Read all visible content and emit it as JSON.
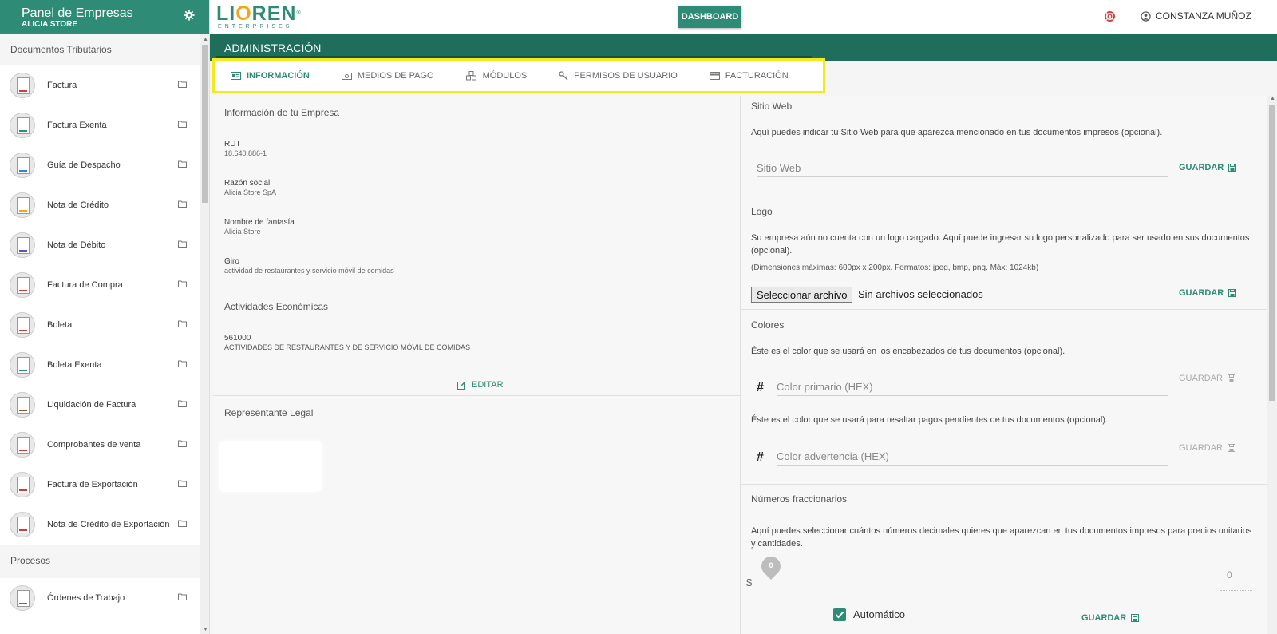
{
  "sidebar": {
    "title": "Panel de Empresas",
    "subtitle": "ALICIA STORE",
    "section1": "Documentos Tributarios",
    "section2": "Procesos",
    "documents": [
      {
        "label": "Factura",
        "color": "#d33a3a"
      },
      {
        "label": "Factura Exenta",
        "color": "#2e8b75"
      },
      {
        "label": "Guía de Despacho",
        "color": "#3b7dd8"
      },
      {
        "label": "Nota de Crédito",
        "color": "#f2a71b"
      },
      {
        "label": "Nota de Débito",
        "color": "#6a4fb3"
      },
      {
        "label": "Factura de Compra",
        "color": "#d33a3a"
      },
      {
        "label": "Boleta",
        "color": "#d33a3a"
      },
      {
        "label": "Boleta Exenta",
        "color": "#2e8b75"
      },
      {
        "label": "Liquidación de Factura",
        "color": "#8b5a2b"
      },
      {
        "label": "Comprobantes de venta",
        "color": "#d33a3a"
      },
      {
        "label": "Factura de Exportación",
        "color": "#d33a3a"
      },
      {
        "label": "Nota de Crédito de Exportación",
        "color": "#d33a3a"
      }
    ],
    "processes": [
      {
        "label": "Órdenes de Trabajo",
        "color": "#d33a3a"
      }
    ]
  },
  "topbar": {
    "logo_main_1": "LI",
    "logo_main_o": "O",
    "logo_main_2": "REN",
    "logo_reg": "®",
    "logo_sub": "ENTERPRISES",
    "dashboard_label": "DASHBOARD",
    "user_name": "CONSTANZA MUÑOZ"
  },
  "admin": {
    "title": "ADMINISTRACIÓN",
    "tabs": [
      {
        "label": "INFORMACIÓN",
        "icon": "id-card-icon",
        "active": true
      },
      {
        "label": "MEDIOS DE PAGO",
        "icon": "money-icon",
        "active": false
      },
      {
        "label": "MÓDULOS",
        "icon": "cubes-icon",
        "active": false
      },
      {
        "label": "PERMISOS DE USUARIO",
        "icon": "key-icon",
        "active": false
      },
      {
        "label": "FACTURACIÓN",
        "icon": "credit-card-icon",
        "active": false
      }
    ]
  },
  "company": {
    "section_title": "Información de tu Empresa",
    "rut_label": "RUT",
    "rut_value": "18.640.886-1",
    "razon_label": "Razón social",
    "razon_value": "Alicia Store SpA",
    "fantasia_label": "Nombre de fantasía",
    "fantasia_value": "Alicia Store",
    "giro_label": "Giro",
    "giro_value": "actividad de restaurantes y servicio móvil de comidas",
    "activities_title": "Actividades Económicas",
    "activity_code": "561000",
    "activity_desc": "ACTIVIDADES DE RESTAURANTES Y DE SERVICIO MÓVIL DE COMIDAS",
    "edit_label": "EDITAR",
    "legal_title": "Representante Legal"
  },
  "settings": {
    "web_title": "Sitio Web",
    "web_desc": "Aquí puedes indicar tu Sitio Web para que aparezca mencionado en tus documentos impresos (opcional).",
    "web_placeholder": "Sitio Web",
    "save_label": "GUARDAR",
    "logo_title": "Logo",
    "logo_desc": "Su empresa aún no cuenta con un logo cargado. Aquí puede ingresar su logo personalizado para ser usado en sus documentos (opcional).",
    "logo_dims": "(Dimensiones máximas: 600px x 200px. Formatos: jpeg, bmp, png. Máx: 1024kb)",
    "file_button": "Seleccionar archivo",
    "file_none": "Sin archivos seleccionados",
    "colors_title": "Colores",
    "color1_desc": "Éste es el color que se usará en los encabezados de tus documentos (opcional).",
    "color1_placeholder": "Color primario (HEX)",
    "color2_desc": "Éste es el color que se usará para resaltar pagos pendientes de tus documentos (opcional).",
    "color2_placeholder": "Color advertencia (HEX)",
    "hash": "#",
    "decimals_title": "Números fraccionarios",
    "decimals_desc": "Aquí puedes seleccionar cuántos números decimales quieres que aparezcan en tus documentos impresos para precios unitarios y cantidades.",
    "currency_symbol": "$",
    "slider_value": "0",
    "slider_max_display": "0",
    "auto_label": "Automático"
  },
  "colors": {
    "primary": "#2e8b75",
    "header_dark": "#1f6e5c",
    "highlight": "#f4e91b",
    "accent_orange": "#f2a71b"
  }
}
